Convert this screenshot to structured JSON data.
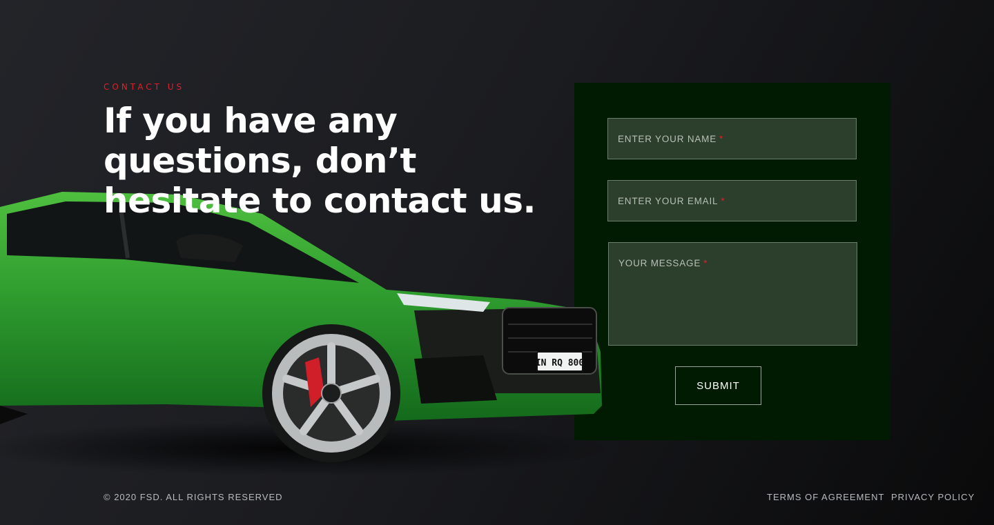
{
  "contact": {
    "eyebrow": "CONTACT US",
    "headline": "If you have any questions, don’t hesitate to contact us."
  },
  "form": {
    "name_placeholder": "ENTER YOUR NAME",
    "email_placeholder": "ENTER YOUR EMAIL",
    "message_placeholder": "YOUR MESSAGE",
    "required_marker": "*",
    "submit_label": "SUBMIT"
  },
  "car": {
    "plate": "IN RQ 800"
  },
  "footer": {
    "copyright": "© 2020 FSD. ALL RIGHTS RESERVED",
    "terms_link": "TERMS OF AGREEMENT",
    "privacy_link": "PRIVACY POLICY"
  },
  "colors": {
    "accent_red": "#e0202b",
    "panel_green": "#001b02",
    "field_green": "#2c3e2c",
    "car_green": "#2f9c2f",
    "background": "#1b1c20"
  }
}
